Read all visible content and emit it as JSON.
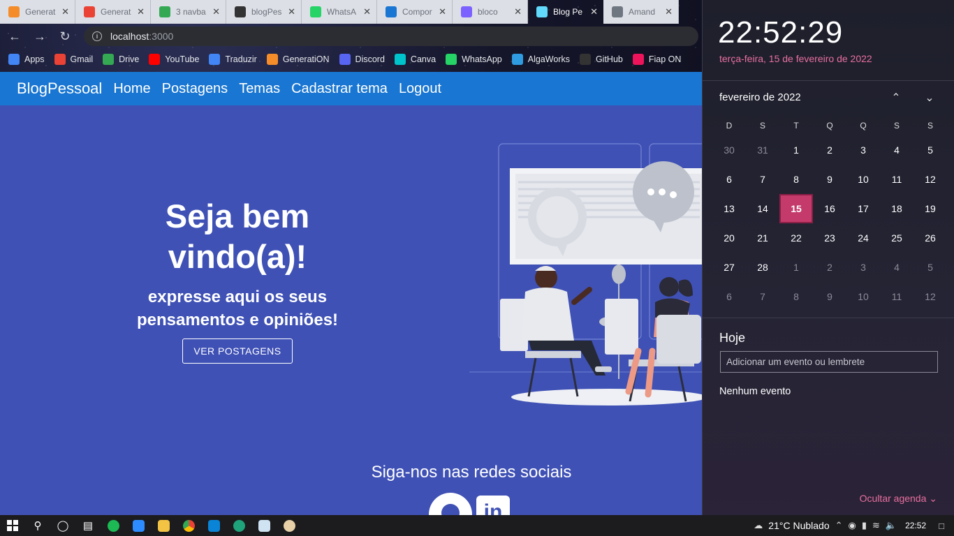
{
  "tabs": [
    {
      "label": "Generat",
      "favicon_color": "#f48c2a",
      "favicon": "cloud-icon"
    },
    {
      "label": "Generat",
      "favicon_color": "#ea4335",
      "favicon": "gmail-icon"
    },
    {
      "label": "3 navba",
      "favicon_color": "#34a853",
      "favicon": "drive-icon"
    },
    {
      "label": "blogPes",
      "favicon_color": "#333333",
      "favicon": "github-icon"
    },
    {
      "label": "WhatsA",
      "favicon_color": "#25d366",
      "favicon": "whatsapp-icon"
    },
    {
      "label": "Compor",
      "favicon_color": "#1976d2",
      "favicon": "mui-icon"
    },
    {
      "label": "bloco",
      "favicon_color": "#7b61ff",
      "favicon": "tab-icon"
    },
    {
      "label": "Blog Pe",
      "favicon_color": "#61dafb",
      "favicon": "react-icon"
    },
    {
      "label": "Amand",
      "favicon_color": "#6e7681",
      "favicon": "github-icon"
    }
  ],
  "address": {
    "host": "localhost",
    "port": ":3000"
  },
  "bookmarks": [
    {
      "label": "Apps",
      "color": "#4285f4"
    },
    {
      "label": "Gmail",
      "color": "#ea4335"
    },
    {
      "label": "Drive",
      "color": "#34a853"
    },
    {
      "label": "YouTube",
      "color": "#ff0000"
    },
    {
      "label": "Traduzir",
      "color": "#4285f4"
    },
    {
      "label": "GeneratiON",
      "color": "#f48c2a"
    },
    {
      "label": "Discord",
      "color": "#5865f2"
    },
    {
      "label": "Canva",
      "color": "#00c4cc"
    },
    {
      "label": "WhatsApp",
      "color": "#25d366"
    },
    {
      "label": "AlgaWorks",
      "color": "#2f9be0"
    },
    {
      "label": "GitHub",
      "color": "#333333"
    },
    {
      "label": "Fiap ON",
      "color": "#ed145b"
    }
  ],
  "navbar": {
    "brand": "BlogPessoal",
    "links": [
      "Home",
      "Postagens",
      "Temas",
      "Cadastrar tema",
      "Logout"
    ]
  },
  "hero": {
    "title_line1": "Seja bem",
    "title_line2": "vindo(a)!",
    "subtitle_line1": "expresse aqui os seus",
    "subtitle_line2": "pensamentos e opiniões!",
    "button": "VER POSTAGENS",
    "social_heading": "Siga-nos nas redes sociais",
    "linkedin_text": "in"
  },
  "flyout": {
    "time": "22:52:29",
    "date_long": "terça-feira, 15 de fevereiro de 2022",
    "month_label": "fevereiro de 2022",
    "weekdays": [
      "D",
      "S",
      "T",
      "Q",
      "Q",
      "S",
      "S"
    ],
    "weeks": [
      [
        "30",
        "31",
        "1",
        "2",
        "3",
        "4",
        "5"
      ],
      [
        "6",
        "7",
        "8",
        "9",
        "10",
        "11",
        "12"
      ],
      [
        "13",
        "14",
        "15",
        "16",
        "17",
        "18",
        "19"
      ],
      [
        "20",
        "21",
        "22",
        "23",
        "24",
        "25",
        "26"
      ],
      [
        "27",
        "28",
        "1",
        "2",
        "3",
        "4",
        "5"
      ],
      [
        "6",
        "7",
        "8",
        "9",
        "10",
        "11",
        "12"
      ]
    ],
    "today": "15",
    "agenda_title": "Hoje",
    "event_placeholder": "Adicionar um evento ou lembrete",
    "no_event": "Nenhum evento",
    "hide_agenda": "Ocultar agenda",
    "accent": "#c43b6b"
  },
  "taskbar": {
    "weather": "21°C  Nublado",
    "time": "22:52"
  }
}
